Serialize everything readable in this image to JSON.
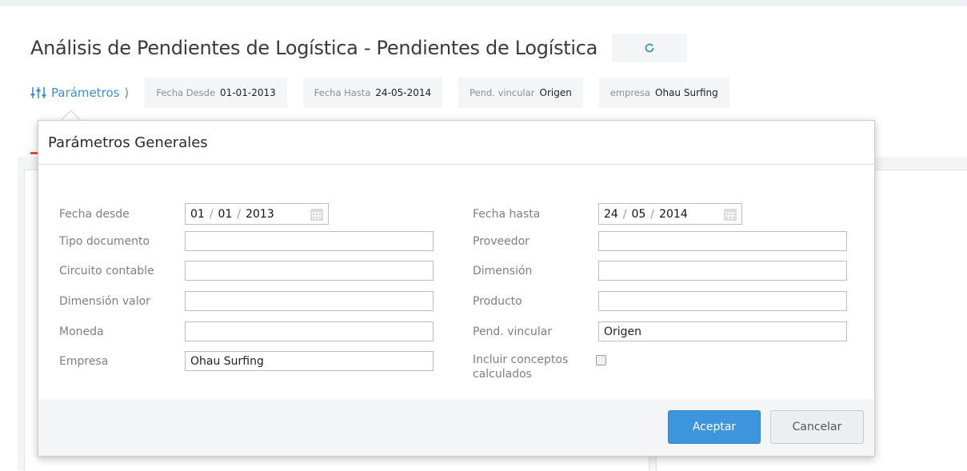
{
  "header": {
    "title": "Análisis de Pendientes de Logística - Pendientes de Logística"
  },
  "params_bar": {
    "link_label": "Parámetros",
    "chips": [
      {
        "label": "Fecha Desde",
        "value": "01-01-2013"
      },
      {
        "label": "Fecha Hasta",
        "value": "24-05-2014"
      },
      {
        "label": "Pend. vincular",
        "value": "Origen"
      },
      {
        "label": "empresa",
        "value": "Ohau Surfing"
      }
    ]
  },
  "dialog": {
    "title": "Parámetros Generales",
    "left_fields": {
      "fecha_desde": {
        "label": "Fecha desde",
        "day": "01",
        "month": "01",
        "year": "2013"
      },
      "tipo_documento": {
        "label": "Tipo documento",
        "value": ""
      },
      "circuito_contable": {
        "label": "Circuito contable",
        "value": ""
      },
      "dimension_valor": {
        "label": "Dimensión valor",
        "value": ""
      },
      "moneda": {
        "label": "Moneda",
        "value": ""
      },
      "empresa": {
        "label": "Empresa",
        "value": "Ohau Surfing"
      }
    },
    "right_fields": {
      "fecha_hasta": {
        "label": "Fecha hasta",
        "day": "24",
        "month": "05",
        "year": "2014"
      },
      "proveedor": {
        "label": "Proveedor",
        "value": ""
      },
      "dimension": {
        "label": "Dimensión",
        "value": ""
      },
      "producto": {
        "label": "Producto",
        "value": ""
      },
      "pend_vincular": {
        "label": "Pend. vincular",
        "value": "Origen"
      },
      "incluir_conceptos": {
        "label_line1": "Incluir conceptos",
        "label_line2": "calculados",
        "checked": false
      }
    },
    "footer": {
      "accept_label": "Aceptar",
      "cancel_label": "Cancelar"
    }
  },
  "colors": {
    "accent": "#3c8fd4",
    "accept_button": "#3d95dd",
    "indicator_red": "#d9534f"
  },
  "icons": {
    "refresh": "refresh-icon",
    "params": "sliders-icon",
    "calendar": "calendar-icon"
  }
}
